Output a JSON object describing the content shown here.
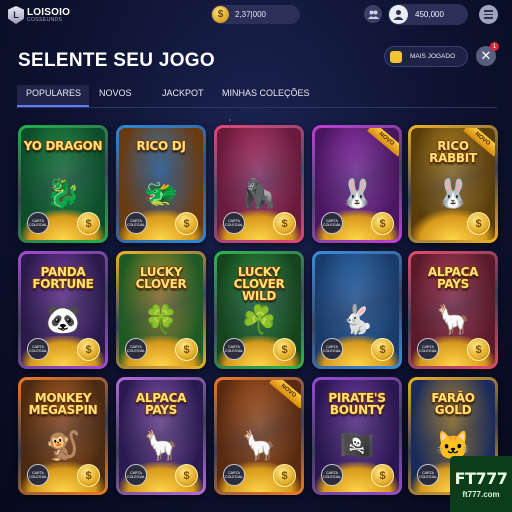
{
  "header": {
    "logo_name": "LOISOIO",
    "logo_sub": "COSSEUNDS",
    "coins_value": "2,37|000",
    "user_balance": "450,000"
  },
  "page": {
    "title": "SELENTE SEU JOGO",
    "filter_label": "MAIS JOGADO",
    "notif_count": "1"
  },
  "tabs": [
    {
      "label": "POPULARES",
      "active": true
    },
    {
      "label": "NOVOS",
      "active": false
    },
    {
      "label": "JACKPOT",
      "active": false
    },
    {
      "label": "MINHAS COLEÇÕES",
      "active": false
    }
  ],
  "games": [
    {
      "title": "YO DRAGON",
      "ribbon": "",
      "badge": "CARTA COLEGIAL",
      "art": "🐉",
      "frame": "#24b24a",
      "bg": "#0d4d2a"
    },
    {
      "title": "RICO DJ",
      "ribbon": "",
      "badge": "CARTA COLEGIAL",
      "art": "🐲",
      "frame": "#2d8bd8",
      "bg": "#6a3a10"
    },
    {
      "title": "",
      "ribbon": "",
      "badge": "CARTA COLEGIAL",
      "art": "🦍",
      "frame": "#e8467b",
      "bg": "#6a1a3a"
    },
    {
      "title": "",
      "ribbon": "NOVO",
      "badge": "CARTA COLEGIAL",
      "art": "🐰",
      "frame": "#c040d8",
      "bg": "#4a1660"
    },
    {
      "title": "RICO RABBIT",
      "ribbon": "NOVO",
      "badge": "",
      "art": "🐰",
      "frame": "#f0b424",
      "bg": "#5a3d0a"
    },
    {
      "title": "PANDA FORTUNE",
      "ribbon": "",
      "badge": "CARTA COLEGIAL",
      "art": "🐼",
      "frame": "#a84ad8",
      "bg": "#2a1a4a"
    },
    {
      "title": "LUCKY CLOVER",
      "ribbon": "",
      "badge": "CARTA COLEGIAL",
      "art": "🍀",
      "frame": "#f0b424",
      "bg": "#1e5a24"
    },
    {
      "title": "LUCKY CLOVER WILD",
      "ribbon": "",
      "badge": "CARTA COLEGIAL",
      "art": "☘️",
      "frame": "#2fb84a",
      "bg": "#16441c"
    },
    {
      "title": "",
      "ribbon": "",
      "badge": "CARTA COLEGIAL",
      "art": "🐇",
      "frame": "#3a8ee0",
      "bg": "#1a3c6a"
    },
    {
      "title": "ALPACA PAYS",
      "ribbon": "",
      "badge": "CARTA COLEGIAL",
      "art": "🦙",
      "frame": "#e84a6a",
      "bg": "#5a1a2a"
    },
    {
      "title": "MONKEY MEGASPIN",
      "ribbon": "",
      "badge": "CARTA COLEGIAL",
      "art": "🐒",
      "frame": "#f07a24",
      "bg": "#4a2a10"
    },
    {
      "title": "ALPACA PAYS",
      "ribbon": "",
      "badge": "CARTA COLEGIAL",
      "art": "🦙",
      "frame": "#b86ae0",
      "bg": "#2a1a50"
    },
    {
      "title": "",
      "ribbon": "NOVO",
      "badge": "CARTA COLEGIAL",
      "art": "🦙",
      "frame": "#f07a24",
      "bg": "#5a2a10"
    },
    {
      "title": "PIRATE'S BOUNTY",
      "ribbon": "",
      "badge": "CARTA COLEGIAL",
      "art": "🏴‍☠️",
      "frame": "#9a4ad8",
      "bg": "#2a1650"
    },
    {
      "title": "FARÃO GOLD",
      "ribbon": "",
      "badge": "CARTA COLEGIAL",
      "art": "🐱",
      "frame": "#f0b424",
      "bg": "#1a2a5a"
    }
  ],
  "watermark": {
    "big": "FT777",
    "small": "ft777.com"
  }
}
